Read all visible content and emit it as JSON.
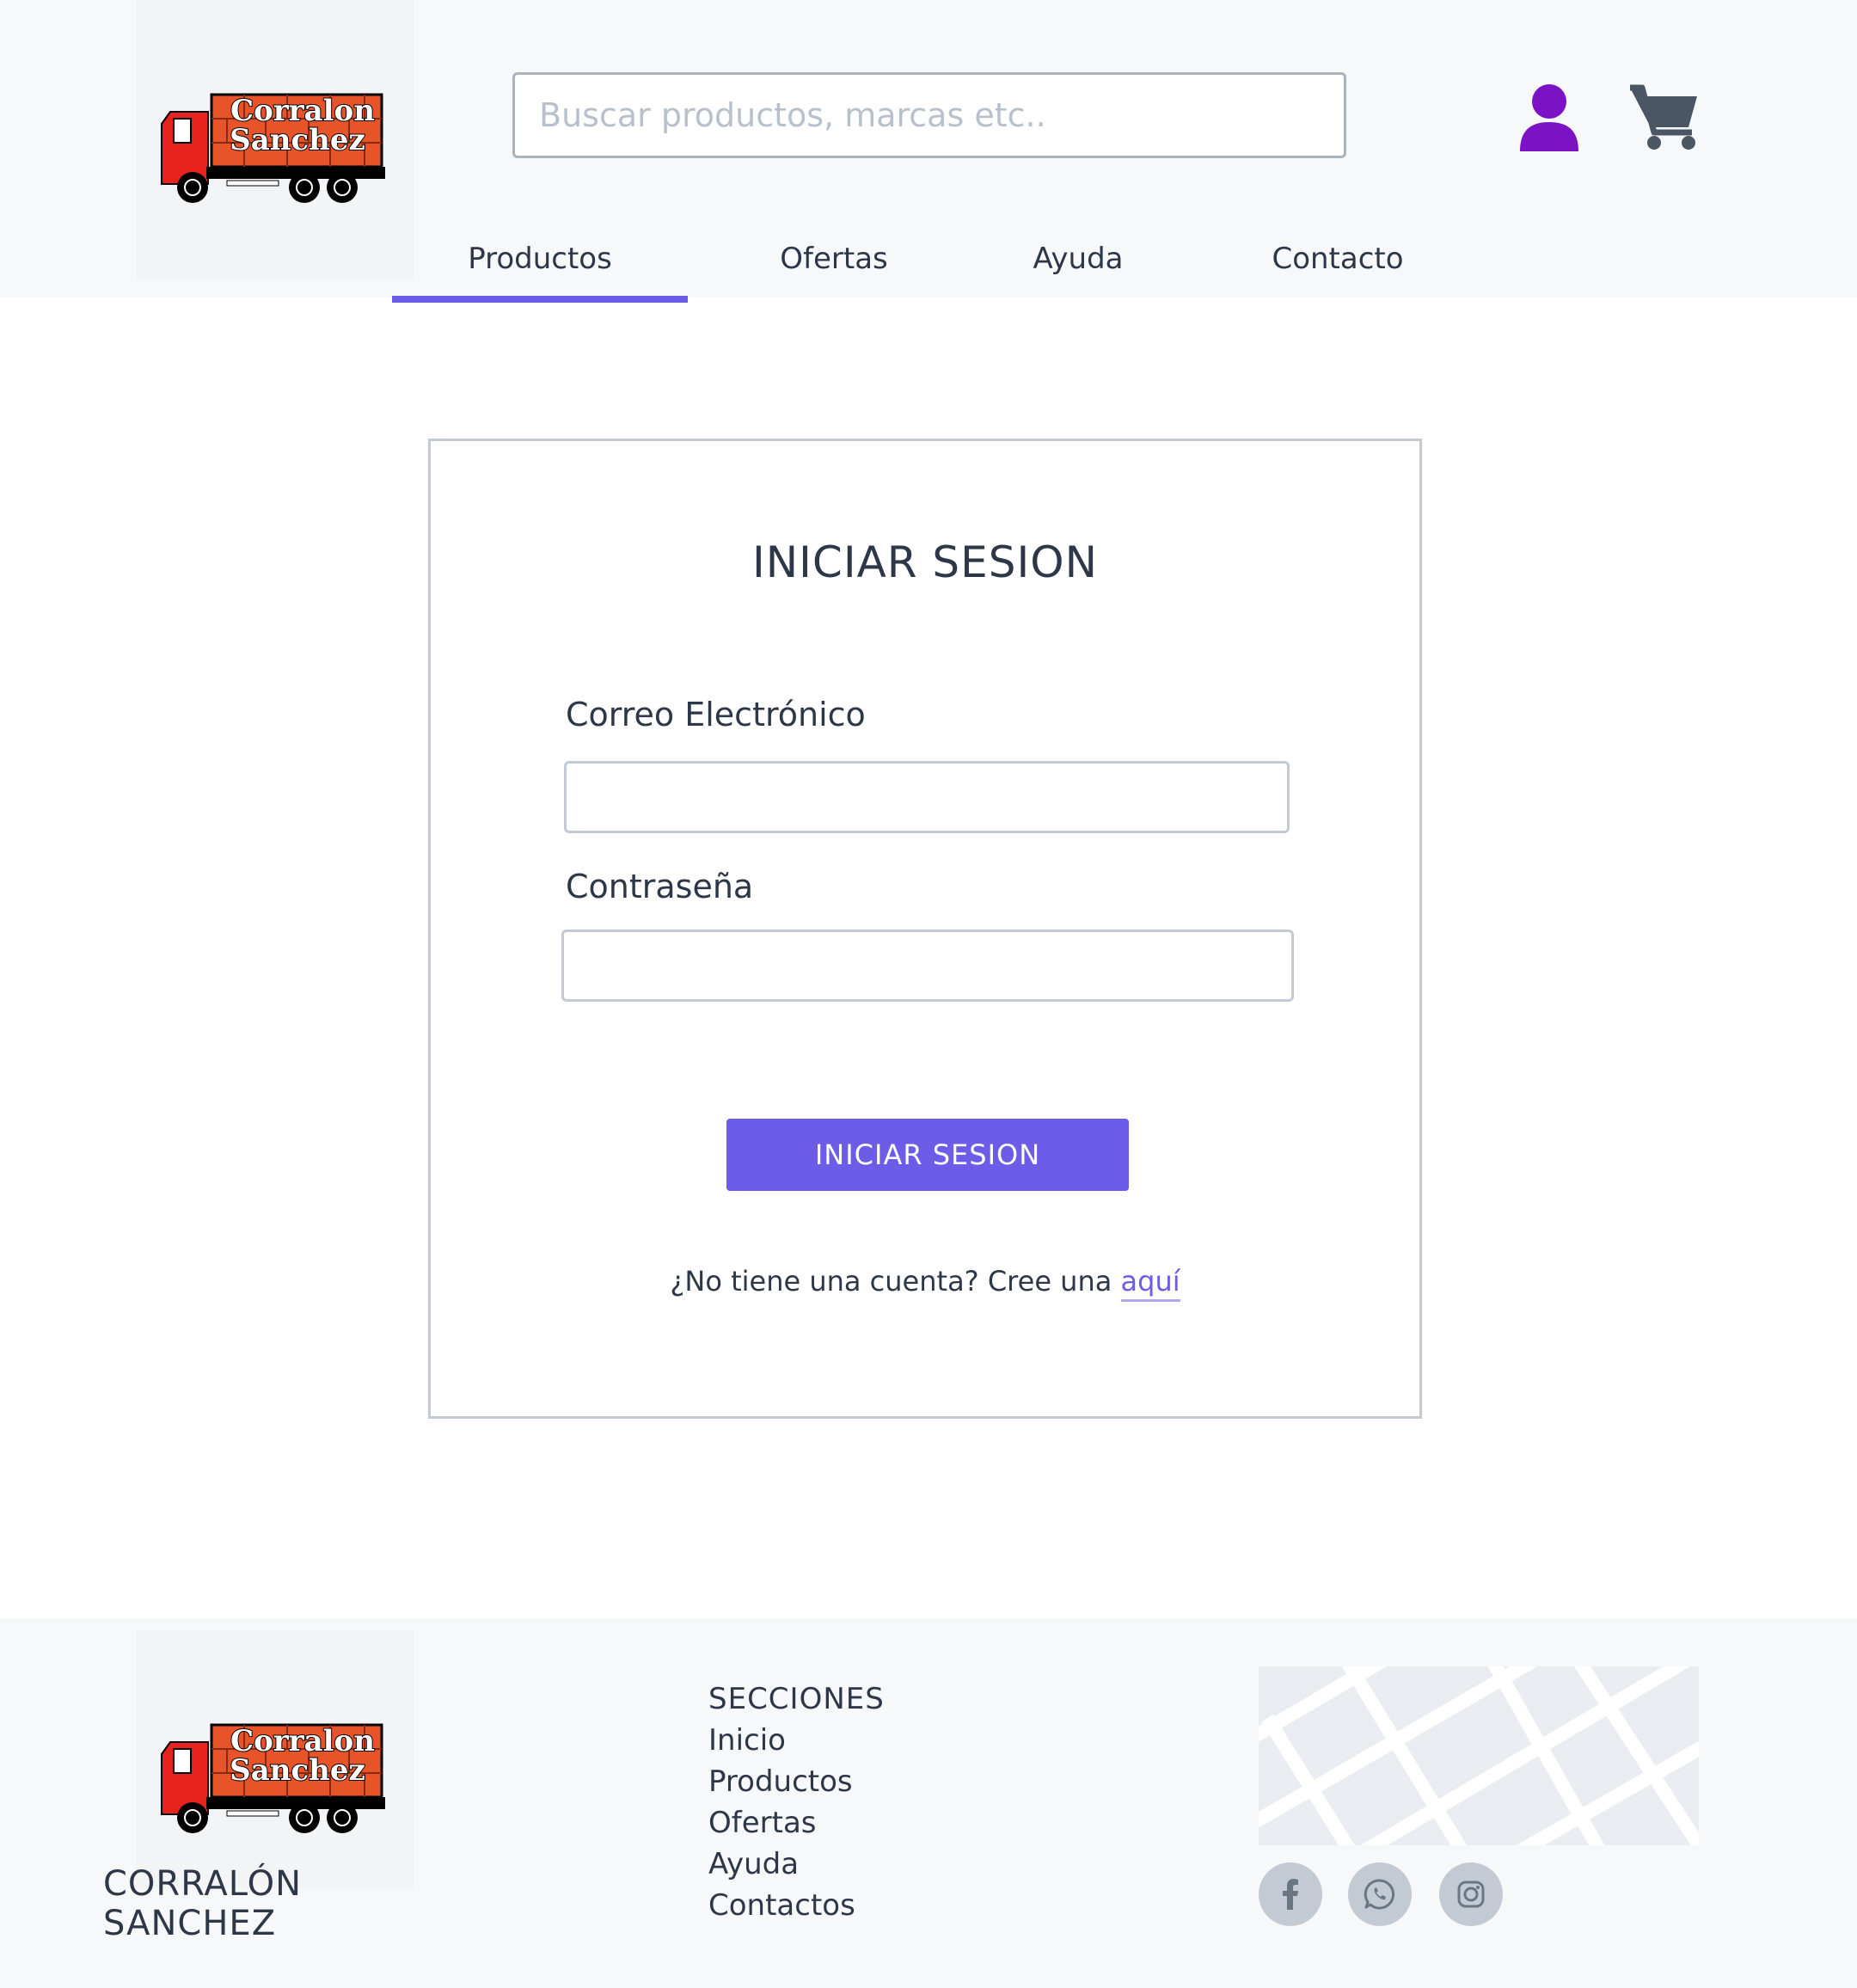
{
  "brand": {
    "logo_line1": "Corralon",
    "logo_line2": "Sanchez",
    "footer_name": "CORRALÓN SANCHEZ",
    "colors": {
      "accent": "#6c5ce7",
      "user_icon": "#7b12c4",
      "cart_icon": "#4a5664",
      "logo_red": "#e8231f",
      "logo_orange": "#e8542a"
    }
  },
  "header": {
    "search": {
      "placeholder": "Buscar productos, marcas etc..",
      "value": ""
    },
    "icons": {
      "user": "user-icon",
      "cart": "cart-icon"
    },
    "nav": [
      {
        "label": "Productos",
        "active": true
      },
      {
        "label": "Ofertas",
        "active": false
      },
      {
        "label": "Ayuda",
        "active": false
      },
      {
        "label": "Contacto",
        "active": false
      }
    ]
  },
  "login": {
    "title": "INICIAR SESION",
    "email_label": "Correo Electrónico",
    "email_value": "",
    "password_label": "Contraseña",
    "password_value": "",
    "submit_label": "INICIAR SESION",
    "signup_prompt": "¿No tiene una cuenta? Cree una",
    "signup_link": "aquí"
  },
  "footer": {
    "sections_title": "SECCIONES",
    "links": [
      "Inicio",
      "Productos",
      "Ofertas",
      "Ayuda",
      "Contactos"
    ],
    "social": [
      "facebook-icon",
      "whatsapp-icon",
      "instagram-icon"
    ]
  }
}
